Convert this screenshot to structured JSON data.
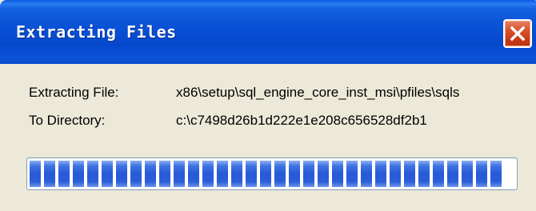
{
  "window": {
    "title": "Extracting Files"
  },
  "fields": [
    {
      "label": "Extracting File:",
      "value": "x86\\setup\\sql_engine_core_inst_msi\\pfiles\\sqls"
    },
    {
      "label": "To Directory:",
      "value": "c:\\c7498d26b1d222e1e208c656528df2b1"
    }
  ],
  "progress": {
    "fraction": 1.0
  },
  "colors": {
    "titlebar": "#0a52d6",
    "body": "#ece9d8",
    "progress_chunk": "#2559d6",
    "close_button": "#d9532e"
  },
  "icons": {
    "close": "close-icon"
  }
}
